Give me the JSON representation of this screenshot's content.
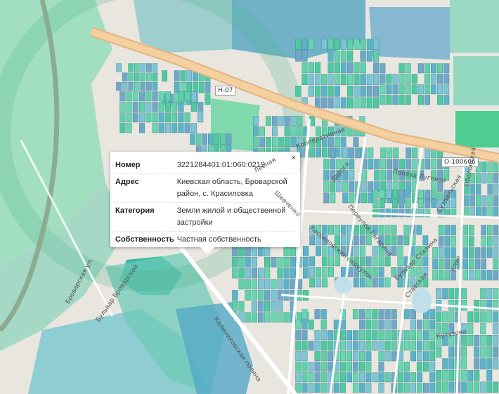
{
  "roads": {
    "h07": "Н-07",
    "o100606": "О-100606"
  },
  "street_labels": [
    "Броварская ул.",
    "Бульвар Броварской",
    "Кооперативная",
    "Кассиловский переулок",
    "Переулок Гагарина",
    "Бульвар Сталина",
    "Суздальская",
    "Оболонская",
    "Кутузова",
    "Калиниковская поляна",
    "Проезд Луговой",
    "Дорога",
    "Ставская",
    "Лесная",
    "Шевченко",
    "Клен"
  ],
  "popup": {
    "close_label": "×",
    "rows": [
      {
        "key": "Номер",
        "value": "3221284401:01:060:0219"
      },
      {
        "key": "Адрес",
        "value": "Киевская область, Броварской район, с. Красиловка"
      },
      {
        "key": "Категория",
        "value": "Земли жилой и общественной застройки"
      },
      {
        "key": "Собственность",
        "value": "Частная собственность"
      }
    ]
  },
  "colors": {
    "parcel_teal": "#5fd1a8",
    "parcel_blue": "#6fa7c9",
    "road_orange": "#f1c48d",
    "background": "#e8e6df"
  }
}
